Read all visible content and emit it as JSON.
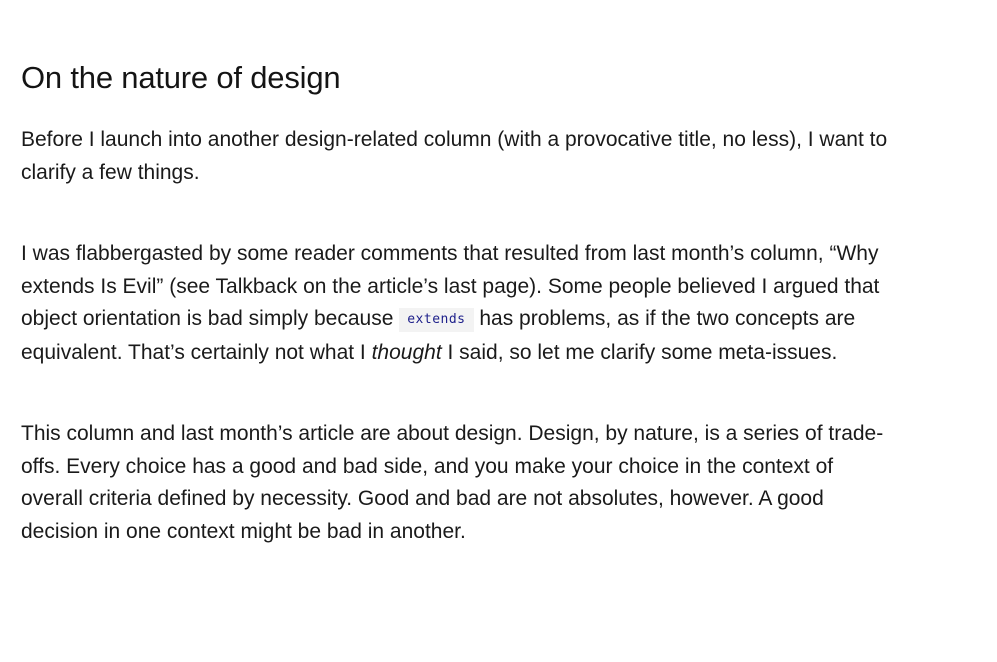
{
  "article": {
    "title": "On the nature of design",
    "paragraph_1": "Before I launch into another design-related column (with a provocative title, no less), I want to clarify a few things.",
    "paragraph_2": {
      "part_a": "I was flabbergasted by some reader comments that resulted from last month’s column, “Why extends Is Evil” (see Talkback on the article’s last page). Some people believed I argued that object orientation is bad simply because ",
      "code": "extends",
      "part_b": " has problems, as if the two concepts are equivalent. That’s certainly not what I ",
      "emphasis": "thought",
      "part_c": " I said, so let me clarify some meta-issues."
    },
    "paragraph_3": "This column and last month’s article are about design. Design, by nature, is a series of trade-offs. Every choice has a good and bad side, and you make your choice in the context of overall criteria defined by necessity. Good and bad are not absolutes, however. A good decision in one context might be bad in another."
  }
}
